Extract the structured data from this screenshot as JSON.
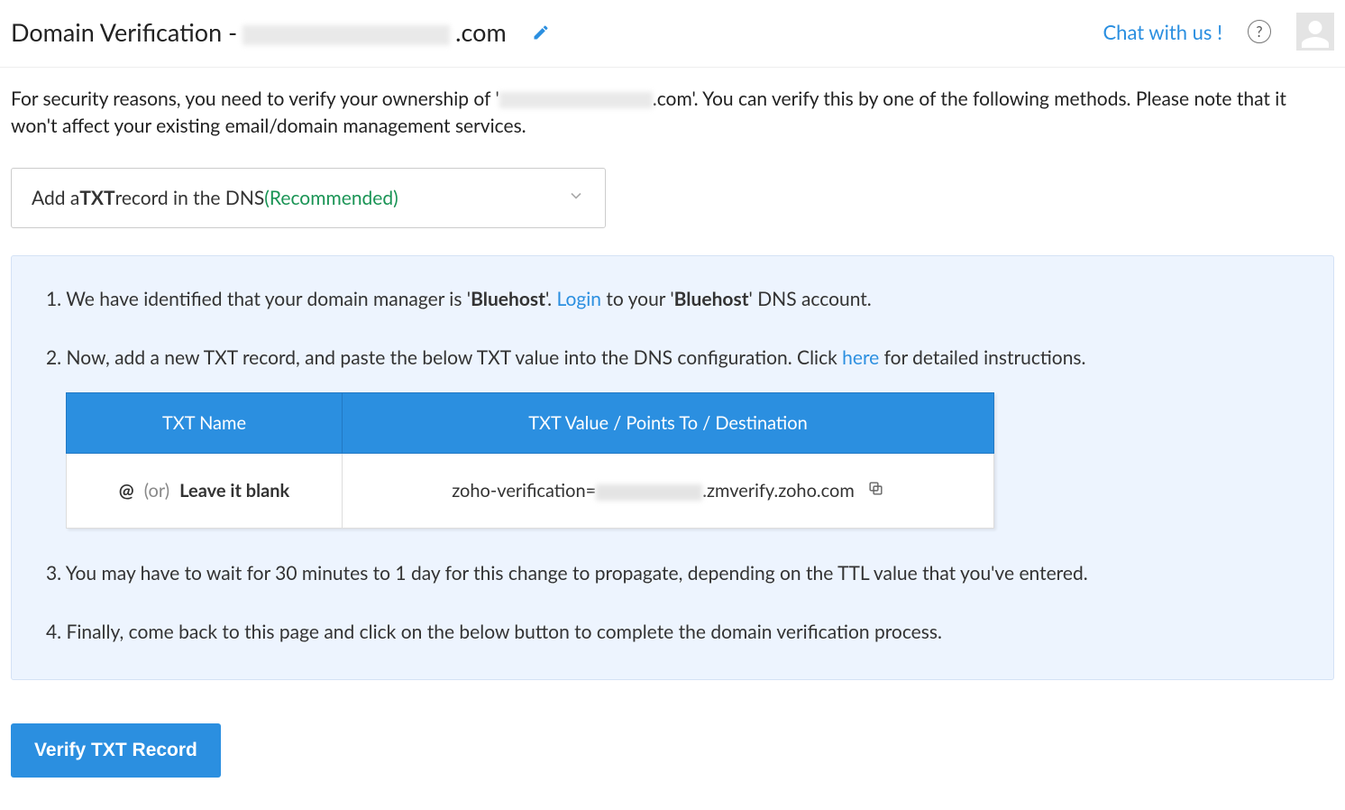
{
  "header": {
    "title_prefix": "Domain Verification - ",
    "domain_suffix": ".com",
    "chat_label": "Chat with us !"
  },
  "intro": {
    "pre": "For security reasons, you need to verify your ownership of '",
    "suffix": ".com'. You can verify this by one of the following methods. Please note that it won't affect your existing email/domain management services."
  },
  "method_select": {
    "prefix": "Add a ",
    "bold": "TXT",
    "mid": " record in the DNS  ",
    "recommended": "(Recommended)"
  },
  "steps": {
    "s1": {
      "num": "1.",
      "a": " We have identified that your domain manager is '",
      "provider": "Bluehost",
      "b": "'. ",
      "login": "Login",
      "c": " to your '",
      "d": "' DNS account."
    },
    "s2": {
      "num": "2.",
      "a": " Now, add a new TXT record, and paste the below TXT value into the DNS configuration. Click ",
      "here": "here",
      "b": " for detailed instructions."
    },
    "s3": {
      "num": "3.",
      "text": " You may have to wait for 30 minutes to 1 day for this change to propagate, depending on the TTL value that you've entered."
    },
    "s4": {
      "num": "4.",
      "text": " Finally, come back to this page and click on the below button to complete the domain verification process."
    }
  },
  "table": {
    "th_name": "TXT Name",
    "th_value": "TXT Value / Points To / Destination",
    "name_at": "@",
    "name_or": "(or)",
    "name_blank": "Leave it blank",
    "value_pre": "zoho-verification=",
    "value_post": ".zmverify.zoho.com"
  },
  "button": {
    "verify": "Verify TXT Record"
  }
}
